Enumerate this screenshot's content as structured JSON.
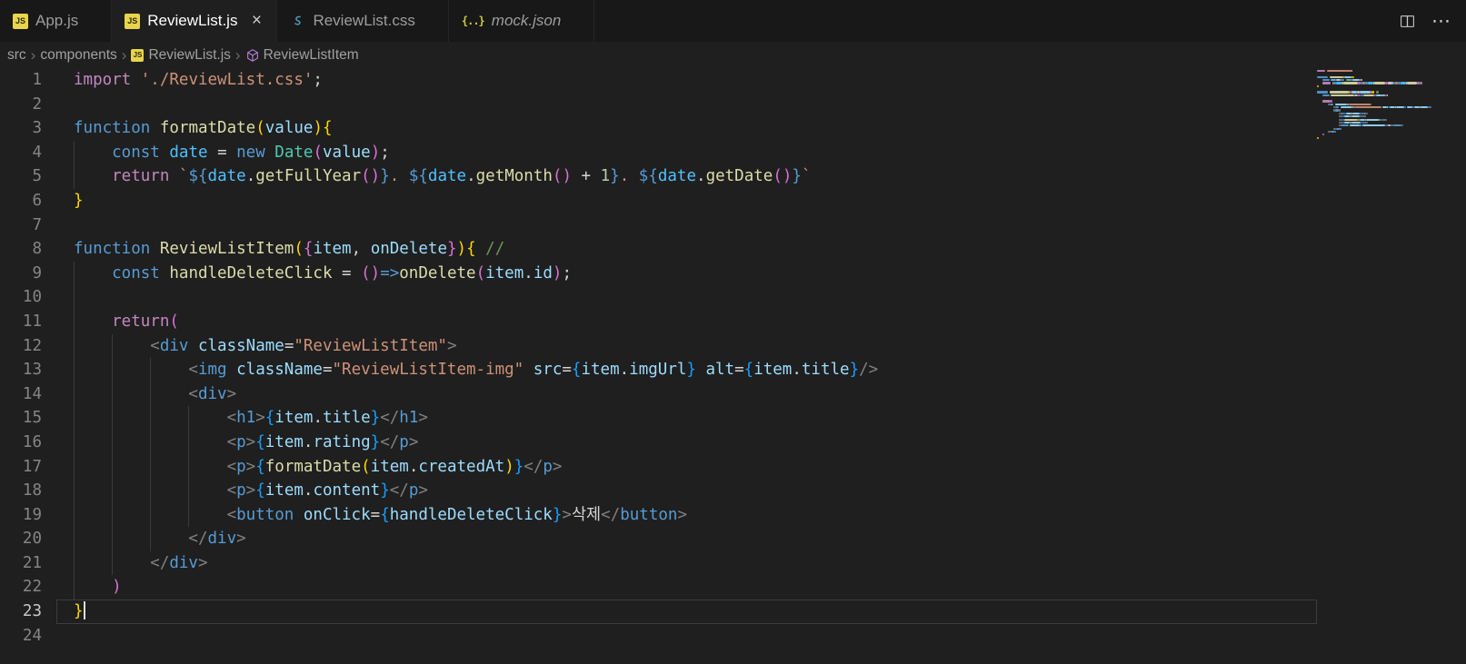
{
  "tabbar": {
    "more_label": "⋯",
    "tabs": [
      {
        "label": "App.js",
        "icon": "js",
        "active": false
      },
      {
        "label": "ReviewList.js",
        "icon": "js",
        "active": true,
        "close": "×"
      },
      {
        "label": "ReviewList.css",
        "icon": "css",
        "active": false
      },
      {
        "label": "mock.json",
        "icon": "json",
        "active": false,
        "italic": true
      }
    ]
  },
  "breadcrumb": {
    "separator": "›",
    "items": [
      {
        "label": "src"
      },
      {
        "label": "components"
      },
      {
        "label": "ReviewList.js",
        "icon": "js"
      },
      {
        "label": "ReviewListItem",
        "icon": "symbol"
      }
    ]
  },
  "palette": {
    "kw1": "#569cd6",
    "kw2": "#c586c0",
    "fn": "#dcdcaa",
    "var": "#9cdcfe",
    "cvar": "#4fc1ff",
    "cls": "#4ec9b0",
    "str": "#ce9178",
    "num": "#b5cea8",
    "pun": "#d4d4d4",
    "tagb": "#808080",
    "tag": "#569cd6",
    "attr": "#9cdcfe",
    "cmt": "#6a9955",
    "b1": "#ffd700",
    "b2": "#da70d6",
    "b3": "#179fff",
    "tpl": "#569cd6",
    "txt": "#d4d4d4"
  },
  "editor": {
    "active_line": 23,
    "cursor": {
      "line": 23,
      "col": 1
    },
    "lines": [
      {
        "n": 1,
        "indent": 0,
        "tokens": [
          [
            "kw2",
            "import"
          ],
          [
            "pun",
            " "
          ],
          [
            "str",
            "'./ReviewList.css'"
          ],
          [
            "pun",
            ";"
          ]
        ]
      },
      {
        "n": 2,
        "indent": 0,
        "tokens": []
      },
      {
        "n": 3,
        "indent": 0,
        "tokens": [
          [
            "kw1",
            "function"
          ],
          [
            "pun",
            " "
          ],
          [
            "fn",
            "formatDate"
          ],
          [
            "b1",
            "("
          ],
          [
            "var",
            "value"
          ],
          [
            "b1",
            ")"
          ],
          [
            "b1",
            "{"
          ]
        ]
      },
      {
        "n": 4,
        "indent": 4,
        "tokens": [
          [
            "kw1",
            "const"
          ],
          [
            "pun",
            " "
          ],
          [
            "cvar",
            "date"
          ],
          [
            "pun",
            " = "
          ],
          [
            "kw1",
            "new"
          ],
          [
            "pun",
            " "
          ],
          [
            "cls",
            "Date"
          ],
          [
            "b2",
            "("
          ],
          [
            "var",
            "value"
          ],
          [
            "b2",
            ")"
          ],
          [
            "pun",
            ";"
          ]
        ]
      },
      {
        "n": 5,
        "indent": 4,
        "tokens": [
          [
            "kw2",
            "return"
          ],
          [
            "pun",
            " "
          ],
          [
            "str",
            "`"
          ],
          [
            "tpl",
            "${"
          ],
          [
            "cvar",
            "date"
          ],
          [
            "pun",
            "."
          ],
          [
            "fn",
            "getFullYear"
          ],
          [
            "b2",
            "()"
          ],
          [
            "tpl",
            "}"
          ],
          [
            "str",
            ". "
          ],
          [
            "tpl",
            "${"
          ],
          [
            "cvar",
            "date"
          ],
          [
            "pun",
            "."
          ],
          [
            "fn",
            "getMonth"
          ],
          [
            "b2",
            "()"
          ],
          [
            "pun",
            " + "
          ],
          [
            "num",
            "1"
          ],
          [
            "tpl",
            "}"
          ],
          [
            "str",
            ". "
          ],
          [
            "tpl",
            "${"
          ],
          [
            "cvar",
            "date"
          ],
          [
            "pun",
            "."
          ],
          [
            "fn",
            "getDate"
          ],
          [
            "b2",
            "()"
          ],
          [
            "tpl",
            "}"
          ],
          [
            "str",
            "`"
          ]
        ]
      },
      {
        "n": 6,
        "indent": 0,
        "tokens": [
          [
            "b1",
            "}"
          ]
        ]
      },
      {
        "n": 7,
        "indent": 0,
        "tokens": []
      },
      {
        "n": 8,
        "indent": 0,
        "tokens": [
          [
            "kw1",
            "function"
          ],
          [
            "pun",
            " "
          ],
          [
            "fn",
            "ReviewListItem"
          ],
          [
            "b1",
            "("
          ],
          [
            "b2",
            "{"
          ],
          [
            "var",
            "item"
          ],
          [
            "pun",
            ", "
          ],
          [
            "var",
            "onDelete"
          ],
          [
            "b2",
            "}"
          ],
          [
            "b1",
            ")"
          ],
          [
            "b1",
            "{"
          ],
          [
            "pun",
            " "
          ],
          [
            "cmt",
            "//"
          ]
        ]
      },
      {
        "n": 9,
        "indent": 4,
        "tokens": [
          [
            "kw1",
            "const"
          ],
          [
            "pun",
            " "
          ],
          [
            "fn",
            "handleDeleteClick"
          ],
          [
            "pun",
            " = "
          ],
          [
            "b2",
            "()"
          ],
          [
            "kw1",
            "=>"
          ],
          [
            "fn",
            "onDelete"
          ],
          [
            "b2",
            "("
          ],
          [
            "var",
            "item"
          ],
          [
            "pun",
            "."
          ],
          [
            "var",
            "id"
          ],
          [
            "b2",
            ")"
          ],
          [
            "pun",
            ";"
          ]
        ]
      },
      {
        "n": 10,
        "indent": 4,
        "tokens": []
      },
      {
        "n": 11,
        "indent": 4,
        "tokens": [
          [
            "kw2",
            "return"
          ],
          [
            "b2",
            "("
          ]
        ]
      },
      {
        "n": 12,
        "indent": 8,
        "tokens": [
          [
            "tagb",
            "<"
          ],
          [
            "tag",
            "div"
          ],
          [
            "pun",
            " "
          ],
          [
            "attr",
            "className"
          ],
          [
            "pun",
            "="
          ],
          [
            "str",
            "\"ReviewListItem\""
          ],
          [
            "tagb",
            ">"
          ]
        ]
      },
      {
        "n": 13,
        "indent": 12,
        "tokens": [
          [
            "tagb",
            "<"
          ],
          [
            "tag",
            "img"
          ],
          [
            "pun",
            " "
          ],
          [
            "attr",
            "className"
          ],
          [
            "pun",
            "="
          ],
          [
            "str",
            "\"ReviewListItem-img\""
          ],
          [
            "pun",
            " "
          ],
          [
            "attr",
            "src"
          ],
          [
            "pun",
            "="
          ],
          [
            "b3",
            "{"
          ],
          [
            "var",
            "item"
          ],
          [
            "pun",
            "."
          ],
          [
            "var",
            "imgUrl"
          ],
          [
            "b3",
            "}"
          ],
          [
            "pun",
            " "
          ],
          [
            "attr",
            "alt"
          ],
          [
            "pun",
            "="
          ],
          [
            "b3",
            "{"
          ],
          [
            "var",
            "item"
          ],
          [
            "pun",
            "."
          ],
          [
            "var",
            "title"
          ],
          [
            "b3",
            "}"
          ],
          [
            "tagb",
            "/>"
          ]
        ]
      },
      {
        "n": 14,
        "indent": 12,
        "tokens": [
          [
            "tagb",
            "<"
          ],
          [
            "tag",
            "div"
          ],
          [
            "tagb",
            ">"
          ]
        ]
      },
      {
        "n": 15,
        "indent": 16,
        "tokens": [
          [
            "tagb",
            "<"
          ],
          [
            "tag",
            "h1"
          ],
          [
            "tagb",
            ">"
          ],
          [
            "b3",
            "{"
          ],
          [
            "var",
            "item"
          ],
          [
            "pun",
            "."
          ],
          [
            "var",
            "title"
          ],
          [
            "b3",
            "}"
          ],
          [
            "tagb",
            "</"
          ],
          [
            "tag",
            "h1"
          ],
          [
            "tagb",
            ">"
          ]
        ]
      },
      {
        "n": 16,
        "indent": 16,
        "tokens": [
          [
            "tagb",
            "<"
          ],
          [
            "tag",
            "p"
          ],
          [
            "tagb",
            ">"
          ],
          [
            "b3",
            "{"
          ],
          [
            "var",
            "item"
          ],
          [
            "pun",
            "."
          ],
          [
            "var",
            "rating"
          ],
          [
            "b3",
            "}"
          ],
          [
            "tagb",
            "</"
          ],
          [
            "tag",
            "p"
          ],
          [
            "tagb",
            ">"
          ]
        ]
      },
      {
        "n": 17,
        "indent": 16,
        "tokens": [
          [
            "tagb",
            "<"
          ],
          [
            "tag",
            "p"
          ],
          [
            "tagb",
            ">"
          ],
          [
            "b3",
            "{"
          ],
          [
            "fn",
            "formatDate"
          ],
          [
            "b1",
            "("
          ],
          [
            "var",
            "item"
          ],
          [
            "pun",
            "."
          ],
          [
            "var",
            "createdAt"
          ],
          [
            "b1",
            ")"
          ],
          [
            "b3",
            "}"
          ],
          [
            "tagb",
            "</"
          ],
          [
            "tag",
            "p"
          ],
          [
            "tagb",
            ">"
          ]
        ]
      },
      {
        "n": 18,
        "indent": 16,
        "tokens": [
          [
            "tagb",
            "<"
          ],
          [
            "tag",
            "p"
          ],
          [
            "tagb",
            ">"
          ],
          [
            "b3",
            "{"
          ],
          [
            "var",
            "item"
          ],
          [
            "pun",
            "."
          ],
          [
            "var",
            "content"
          ],
          [
            "b3",
            "}"
          ],
          [
            "tagb",
            "</"
          ],
          [
            "tag",
            "p"
          ],
          [
            "tagb",
            ">"
          ]
        ]
      },
      {
        "n": 19,
        "indent": 16,
        "tokens": [
          [
            "tagb",
            "<"
          ],
          [
            "tag",
            "button"
          ],
          [
            "pun",
            " "
          ],
          [
            "attr",
            "onClick"
          ],
          [
            "pun",
            "="
          ],
          [
            "b3",
            "{"
          ],
          [
            "var",
            "handleDeleteClick"
          ],
          [
            "b3",
            "}"
          ],
          [
            "tagb",
            ">"
          ],
          [
            "txt",
            "삭제"
          ],
          [
            "tagb",
            "</"
          ],
          [
            "tag",
            "button"
          ],
          [
            "tagb",
            ">"
          ]
        ]
      },
      {
        "n": 20,
        "indent": 12,
        "tokens": [
          [
            "tagb",
            "</"
          ],
          [
            "tag",
            "div"
          ],
          [
            "tagb",
            ">"
          ]
        ]
      },
      {
        "n": 21,
        "indent": 8,
        "tokens": [
          [
            "tagb",
            "</"
          ],
          [
            "tag",
            "div"
          ],
          [
            "tagb",
            ">"
          ]
        ]
      },
      {
        "n": 22,
        "indent": 4,
        "tokens": [
          [
            "b2",
            ")"
          ]
        ]
      },
      {
        "n": 23,
        "indent": 0,
        "tokens": [
          [
            "b1",
            "}"
          ]
        ]
      },
      {
        "n": 24,
        "indent": 0,
        "tokens": []
      }
    ]
  }
}
